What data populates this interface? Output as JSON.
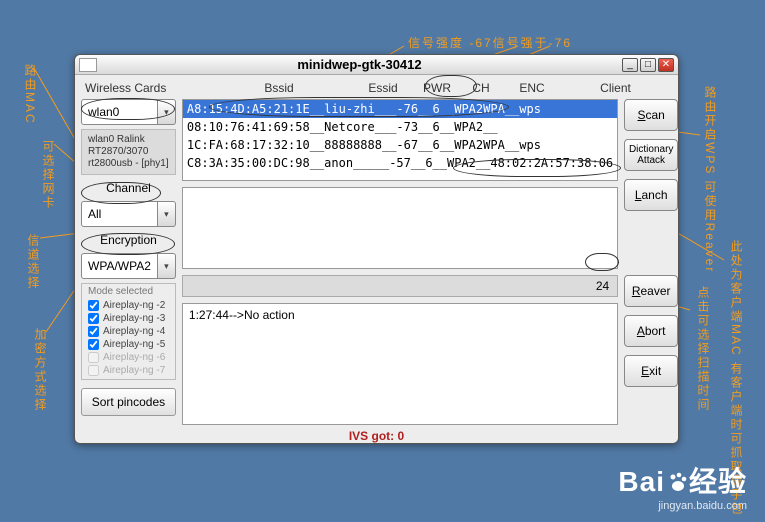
{
  "window": {
    "title": "minidwep-gtk-30412"
  },
  "headers": {
    "wc": "Wireless Cards",
    "bssid": "Bssid",
    "essid": "Essid",
    "pwr": "PWR",
    "ch": "CH",
    "enc": "ENC",
    "client": "Client"
  },
  "adapter_detail": "wlan0 Ralink RT2870/3070 rt2800usb - [phy1]",
  "labels": {
    "channel": "Channel",
    "encryption": "Encryption",
    "mode": "Mode selected"
  },
  "combo": {
    "iface": "wlan0",
    "channel": "All",
    "enc": "WPA/WPA2"
  },
  "modes": [
    {
      "label": "Aireplay-ng -2",
      "checked": true,
      "disabled": false
    },
    {
      "label": "Aireplay-ng -3",
      "checked": true,
      "disabled": false
    },
    {
      "label": "Aireplay-ng -4",
      "checked": true,
      "disabled": false
    },
    {
      "label": "Aireplay-ng -5",
      "checked": true,
      "disabled": false
    },
    {
      "label": "Aireplay-ng -6",
      "checked": false,
      "disabled": true
    },
    {
      "label": "Aireplay-ng -7",
      "checked": false,
      "disabled": true
    }
  ],
  "sort_btn": "Sort pincodes",
  "networks": [
    "A8:15:4D:A5:21:1E__liu-zhi___-76__6__WPA2WPA__wps",
    "08:10:76:41:69:58__Netcore___-73__6__WPA2__",
    "1C:FA:68:17:32:10__88888888__-67__6__WPA2WPA__wps",
    "C8:3A:35:00:DC:98__anon_____-57__6__WPA2__48:02:2A:57:38:06"
  ],
  "stat_count": "24",
  "log_line": "1:27:44-->No action",
  "buttons": {
    "scan": "Scan",
    "dict": "Dictionary Attack",
    "launch": "Lanch",
    "reaver": "Reaver",
    "abort": "Abort",
    "exit": "Exit"
  },
  "footer": "IVS got: 0",
  "annotations": {
    "top": "信号强度 -67信号强于-76",
    "left1": "路由MAC",
    "left2": "可选择网卡",
    "left3": "信道选择",
    "left4": "加密方式选择",
    "right1": "路由开启WPS 可使用Reaver",
    "right2": "此处为客户端MAC 有客户端时可抓取握手包",
    "right3": "点击可选择扫描时间"
  },
  "watermark": {
    "main": "Baidu 经验",
    "sub": "jingyan.baidu.com"
  }
}
